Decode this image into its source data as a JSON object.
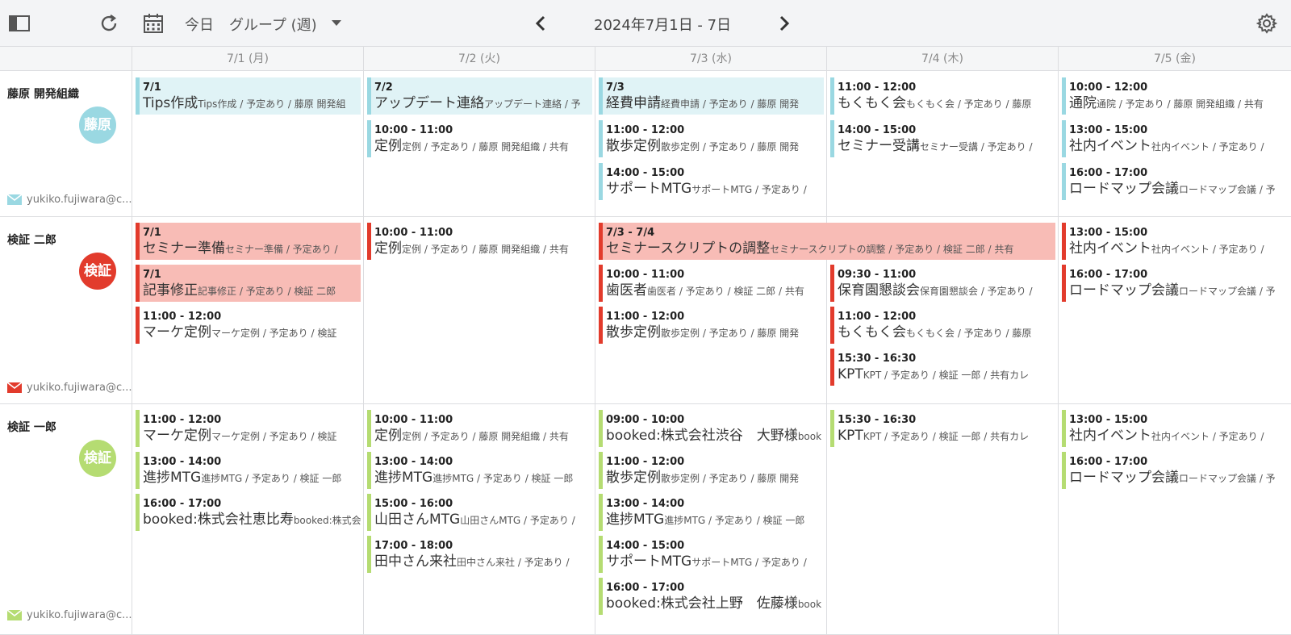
{
  "toolbar": {
    "today_label": "今日",
    "view_label": "グループ (週)",
    "date_range": "2024年7月1日 - 7日"
  },
  "days": [
    "7/1 (月)",
    "7/2 (火)",
    "7/3 (水)",
    "7/4 (木)",
    "7/5 (金)"
  ],
  "colors": {
    "blue": "#9ad8e2",
    "red": "#e23b2c",
    "green": "#b5dc72",
    "blue_bg": "#e0f3f6",
    "red_bg": "#f8bcb6"
  },
  "members": [
    {
      "name": "藤原 開発組織",
      "avatar": "藤原",
      "email": "yukiko.fujiwara@c...",
      "events": [
        {
          "time": "7/1",
          "title": "Tips作成",
          "detail": "Tips作成 / 予定あり / 藤原 開発組"
        },
        {
          "time": "7/2",
          "title": "アップデート連絡",
          "detail": "アップデート連絡 / 予"
        },
        {
          "time": "10:00 - 11:00",
          "title": "定例",
          "detail": "定例 / 予定あり / 藤原 開発組織 / 共有"
        },
        {
          "time": "7/3",
          "title": "経費申請",
          "detail": "経費申請 / 予定あり / 藤原 開発"
        },
        {
          "time": "11:00 - 12:00",
          "title": "散歩定例",
          "detail": "散歩定例 / 予定あり / 藤原 開発"
        },
        {
          "time": "14:00 - 15:00",
          "title": "サポートMTG",
          "detail": "サポートMTG / 予定あり /"
        },
        {
          "time": "11:00 - 12:00",
          "title": "もくもく会",
          "detail": "もくもく会 / 予定あり / 藤原"
        },
        {
          "time": "14:00 - 15:00",
          "title": "セミナー受講",
          "detail": "セミナー受講 / 予定あり /"
        },
        {
          "time": "10:00 - 12:00",
          "title": "通院",
          "detail": "通院 / 予定あり / 藤原 開発組織 / 共有"
        },
        {
          "time": "13:00 - 15:00",
          "title": "社内イベント",
          "detail": "社内イベント / 予定あり /"
        },
        {
          "time": "16:00 - 17:00",
          "title": "ロードマップ会議",
          "detail": "ロードマップ会議 / 予"
        }
      ]
    },
    {
      "name": "検証 二郎",
      "avatar": "検証",
      "email": "yukiko.fujiwara@c...",
      "events": [
        {
          "time": "7/1",
          "title": "セミナー準備",
          "detail": "セミナー準備 / 予定あり /"
        },
        {
          "time": "7/1",
          "title": "記事修正",
          "detail": "記事修正 / 予定あり / 検証 二郎"
        },
        {
          "time": "11:00 - 12:00",
          "title": "マーケ定例",
          "detail": "マーケ定例 / 予定あり / 検証"
        },
        {
          "time": "10:00 - 11:00",
          "title": "定例",
          "detail": "定例 / 予定あり / 藤原 開発組織 / 共有"
        },
        {
          "time": "7/3 - 7/4",
          "title": "セミナースクリプトの調整",
          "detail": "セミナースクリプトの調整 / 予定あり / 検証 二郎 / 共有"
        },
        {
          "time": "10:00 - 11:00",
          "title": "歯医者",
          "detail": "歯医者 / 予定あり / 検証 二郎 / 共有"
        },
        {
          "time": "11:00 - 12:00",
          "title": "散歩定例",
          "detail": "散歩定例 / 予定あり / 藤原 開発"
        },
        {
          "time": "09:30 - 11:00",
          "title": "保育園懇談会",
          "detail": "保育園懇談会 / 予定あり /"
        },
        {
          "time": "11:00 - 12:00",
          "title": "もくもく会",
          "detail": "もくもく会 / 予定あり / 藤原"
        },
        {
          "time": "15:30 - 16:30",
          "title": "KPT",
          "detail": "KPT / 予定あり / 検証 一郎 / 共有カレ"
        },
        {
          "time": "13:00 - 15:00",
          "title": "社内イベント",
          "detail": "社内イベント / 予定あり /"
        },
        {
          "time": "16:00 - 17:00",
          "title": "ロードマップ会議",
          "detail": "ロードマップ会議 / 予"
        }
      ]
    },
    {
      "name": "検証 一郎",
      "avatar": "検証",
      "email": "yukiko.fujiwara@c...",
      "events": [
        {
          "time": "11:00 - 12:00",
          "title": "マーケ定例",
          "detail": "マーケ定例 / 予定あり / 検証"
        },
        {
          "time": "13:00 - 14:00",
          "title": "進捗MTG",
          "detail": "進捗MTG / 予定あり / 検証 一郎"
        },
        {
          "time": "16:00 - 17:00",
          "title": "booked:株式会社恵比寿",
          "detail": "booked:株式会"
        },
        {
          "time": "10:00 - 11:00",
          "title": "定例",
          "detail": "定例 / 予定あり / 藤原 開発組織 / 共有"
        },
        {
          "time": "13:00 - 14:00",
          "title": "進捗MTG",
          "detail": "進捗MTG / 予定あり / 検証 一郎"
        },
        {
          "time": "15:00 - 16:00",
          "title": "山田さんMTG",
          "detail": "山田さんMTG / 予定あり /"
        },
        {
          "time": "17:00 - 18:00",
          "title": "田中さん来社",
          "detail": "田中さん来社 / 予定あり /"
        },
        {
          "time": "09:00 - 10:00",
          "title": "booked:株式会社渋谷　大野様",
          "detail": "book"
        },
        {
          "time": "11:00 - 12:00",
          "title": "散歩定例",
          "detail": "散歩定例 / 予定あり / 藤原 開発"
        },
        {
          "time": "13:00 - 14:00",
          "title": "進捗MTG",
          "detail": "進捗MTG / 予定あり / 検証 一郎"
        },
        {
          "time": "14:00 - 15:00",
          "title": "サポートMTG",
          "detail": "サポートMTG / 予定あり /"
        },
        {
          "time": "16:00 - 17:00",
          "title": "booked:株式会社上野　佐藤様",
          "detail": "book"
        },
        {
          "time": "15:30 - 16:30",
          "title": "KPT",
          "detail": "KPT / 予定あり / 検証 一郎 / 共有カレ"
        },
        {
          "time": "13:00 - 15:00",
          "title": "社内イベント",
          "detail": "社内イベント / 予定あり /"
        },
        {
          "time": "16:00 - 17:00",
          "title": "ロードマップ会議",
          "detail": "ロードマップ会議 / 予"
        }
      ]
    }
  ]
}
